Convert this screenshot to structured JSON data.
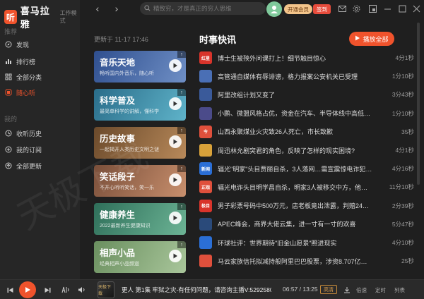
{
  "app": {
    "logo_text": "听",
    "name": "喜马拉雅",
    "mode": "工作模式"
  },
  "sidebar": {
    "section_recommend": "推荐",
    "section_mine": "我的",
    "recommend_items": [
      {
        "label": "发现",
        "icon": "compass-icon"
      },
      {
        "label": "排行榜",
        "icon": "ranking-icon"
      },
      {
        "label": "全部分类",
        "icon": "grid-icon"
      },
      {
        "label": "随心听",
        "icon": "shuffle-listen-icon"
      }
    ],
    "mine_items": [
      {
        "label": "收听历史",
        "icon": "history-icon"
      },
      {
        "label": "我的订阅",
        "icon": "subscribe-icon"
      },
      {
        "label": "全部更新",
        "icon": "update-icon"
      }
    ],
    "accent": "#f0532c"
  },
  "topbar": {
    "search_placeholder": "精致穷，才是真正的穷人思维",
    "vip_label": "开通会员",
    "sign_label": "签到",
    "icons": [
      "mail-icon",
      "settings-icon",
      "mini-mode-icon",
      "minimize-icon",
      "maximize-icon",
      "close-icon"
    ]
  },
  "main": {
    "update_time": "更新于 11-17 17:46",
    "cards": [
      {
        "title": "音乐天地",
        "subtitle": "畅听国内外音乐，随心听",
        "color1": "#2f4f8f",
        "color2": "#6f8fc5"
      },
      {
        "title": "科学普及",
        "subtitle": "最简单科学的讲解，懂科学",
        "color1": "#2a6d8a",
        "color2": "#5fb3c9"
      },
      {
        "title": "历史故事",
        "subtitle": "一起揭开人类历史文明之谜",
        "color1": "#6b4a2b",
        "color2": "#b8895a"
      },
      {
        "title": "笑话段子",
        "subtitle": "不开心听听笑话，笑一乐",
        "color1": "#7a4f3a",
        "color2": "#c88f6d"
      },
      {
        "title": "健康养生",
        "subtitle": "2022最新养生健康知识",
        "color1": "#2f6f5a",
        "color2": "#6cb495"
      },
      {
        "title": "相声小品",
        "subtitle": "经典相声小品频道",
        "color1": "#6a8f5f",
        "color2": "#a9c69b"
      }
    ]
  },
  "news": {
    "section_title": "时事快讯",
    "play_all_label": "播放全部",
    "items": [
      {
        "title": "博士生被殃外问课打上！细节触目惊心",
        "duration": "4分1秒",
        "thumb": "红星",
        "color": "#d9342b"
      },
      {
        "title": "高管通自媒体有辱诽谤，格力报案公安机关已受理",
        "duration": "1分10秒",
        "thumb": "",
        "color": "#4a6fb5"
      },
      {
        "title": "阿里改组计划又变了",
        "duration": "3分43秒",
        "thumb": "",
        "color": "#3a5a9a"
      },
      {
        "title": "小鹏、微盟风格占优，资金在汽车、半导体线中高低切换",
        "duration": "1分10秒",
        "thumb": "",
        "color": "#4b4b8a"
      },
      {
        "title": "山西永聚煤业火灾致26人死亡，市长致歉",
        "duration": "35秒",
        "thumb": "今",
        "color": "#e0503c"
      },
      {
        "title": "周迅林允剧突君的角色，反映了怎样的现实困境?",
        "duration": "4分1秒",
        "thumb": "",
        "color": "#d9a23a"
      },
      {
        "title": "辐光\"明家\"头目贾丽自杀，3人落网…需宣震惊电诈犯…",
        "duration": "4分16秒",
        "thumb": "新闻",
        "color": "#2b6fd6"
      },
      {
        "title": "辐光电诈头目明学昌自杀，明家3人被移交中方，他们…",
        "duration": "11分10秒",
        "thumb": "正观",
        "color": "#e0503c"
      },
      {
        "title": "男子彩票号码中500万元，店老板竟出泄露，判赔24万元…",
        "duration": "2分39秒",
        "thumb": "极目",
        "color": "#d9342b"
      },
      {
        "title": "APEC峰会，商界大佬云集，进一寸有一寸的欢喜",
        "duration": "5分47秒",
        "thumb": "",
        "color": "#2a4a7a"
      },
      {
        "title": "环球社评：世界期待\"旧金山愿景\"照进现实",
        "duration": "4分10秒",
        "thumb": "",
        "color": "#2b6fd6"
      },
      {
        "title": "马云家族信托拟减持般阿里巴巴股票，涉资8.707亿美元",
        "duration": "25秒",
        "thumb": "",
        "color": "#e0503c"
      }
    ]
  },
  "player": {
    "cover_text": "天极下载",
    "title": "更人 第1集 牢狱之灾-有任何问题，请咨询主播V:5292580…",
    "time": "06:57 / 13:25",
    "quality": "高清",
    "labels": [
      "倍速",
      "定时",
      "列表"
    ]
  },
  "watermark": "天极下载"
}
